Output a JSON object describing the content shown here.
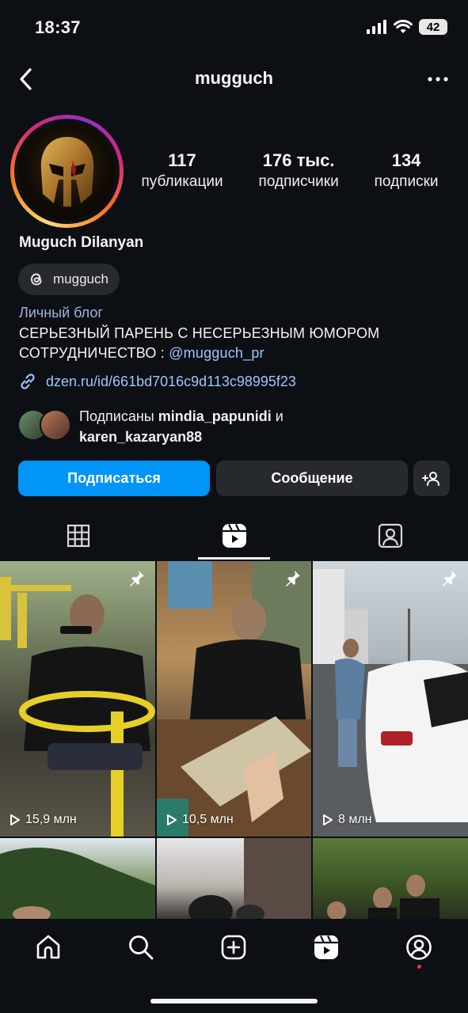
{
  "status_bar": {
    "time": "18:37",
    "battery": "42",
    "icons": [
      "signal-icon",
      "wifi-icon",
      "battery-icon"
    ]
  },
  "nav": {
    "title": "mugguch",
    "back_icon": "chevron-left-icon",
    "more_icon": "more-horizontal-icon"
  },
  "profile": {
    "stats": [
      {
        "value": "117",
        "label": "публикации"
      },
      {
        "value": "176 тыс.",
        "label": "подписчики"
      },
      {
        "value": "134",
        "label": "подписки"
      }
    ],
    "display_name": "Muguch Dilanyan",
    "threads_handle": "mugguch",
    "category": "Личный блог",
    "bio_line_1": "СЕРЬЕЗНЫЙ ПАРЕНЬ С НЕСЕРЬЕЗНЫМ ЮМОРОМ",
    "bio_line_2_prefix": "СОТРУДНИЧЕСТВО : ",
    "bio_mention": "@mugguch_pr",
    "link": "dzen.ru/id/661bd7016c9d113c98995f23",
    "followed_by": {
      "prefix": "Подписаны ",
      "user_1": "mindia_papunidi",
      "joiner": " и",
      "user_2": "karen_kazaryan88"
    }
  },
  "actions": {
    "follow": "Подписаться",
    "message": "Сообщение"
  },
  "tabs": [
    {
      "name": "grid",
      "icon": "grid-icon"
    },
    {
      "name": "reels",
      "icon": "reels-icon",
      "active": true
    },
    {
      "name": "tagged",
      "icon": "tagged-user-icon"
    }
  ],
  "reels": [
    {
      "views": "15,9 млн",
      "pinned": true
    },
    {
      "views": "10,5 млн",
      "pinned": true
    },
    {
      "views": "8 млн",
      "pinned": true
    },
    {
      "views": ""
    },
    {
      "views": ""
    },
    {
      "views": ""
    }
  ],
  "bottom_nav": [
    "home-icon",
    "search-icon",
    "create-icon",
    "reels-icon",
    "profile-icon"
  ],
  "colors": {
    "background": "#0c1014",
    "primary_button": "#0095f6",
    "secondary_button": "#262a2f",
    "link": "#a0c4ff",
    "notification_dot": "#ff3040"
  }
}
